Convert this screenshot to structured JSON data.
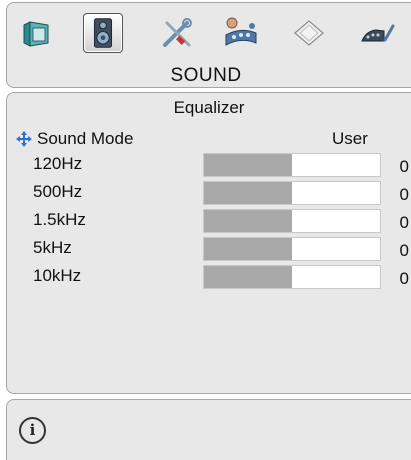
{
  "header": {
    "tabs": [
      {
        "icon": "picture-icon",
        "selected": false
      },
      {
        "icon": "speaker-icon",
        "selected": true
      },
      {
        "icon": "settings-tools-icon",
        "selected": false
      },
      {
        "icon": "network-icon",
        "selected": false
      },
      {
        "icon": "document-icon",
        "selected": false
      },
      {
        "icon": "antenna-tuner-icon",
        "selected": false
      }
    ],
    "section_title": "SOUND"
  },
  "equalizer": {
    "title": "Equalizer",
    "sound_mode": {
      "label": "Sound Mode",
      "value": "User",
      "icon": "move-arrows-icon"
    },
    "bands": [
      {
        "label": "120Hz",
        "value": "0",
        "level": 0.5
      },
      {
        "label": "500Hz",
        "value": "0",
        "level": 0.5
      },
      {
        "label": "1.5kHz",
        "value": "0",
        "level": 0.5
      },
      {
        "label": "5kHz",
        "value": "0",
        "level": 0.5
      },
      {
        "label": "10kHz",
        "value": "0",
        "level": 0.5
      }
    ]
  },
  "footer": {
    "info_icon": "info-icon"
  },
  "colors": {
    "panel": "#e8e8e8",
    "border": "#a6a6a6",
    "bar_fill": "#a9a9a9",
    "bar_track": "#ffffff",
    "accent_blue": "#2f6fce"
  }
}
